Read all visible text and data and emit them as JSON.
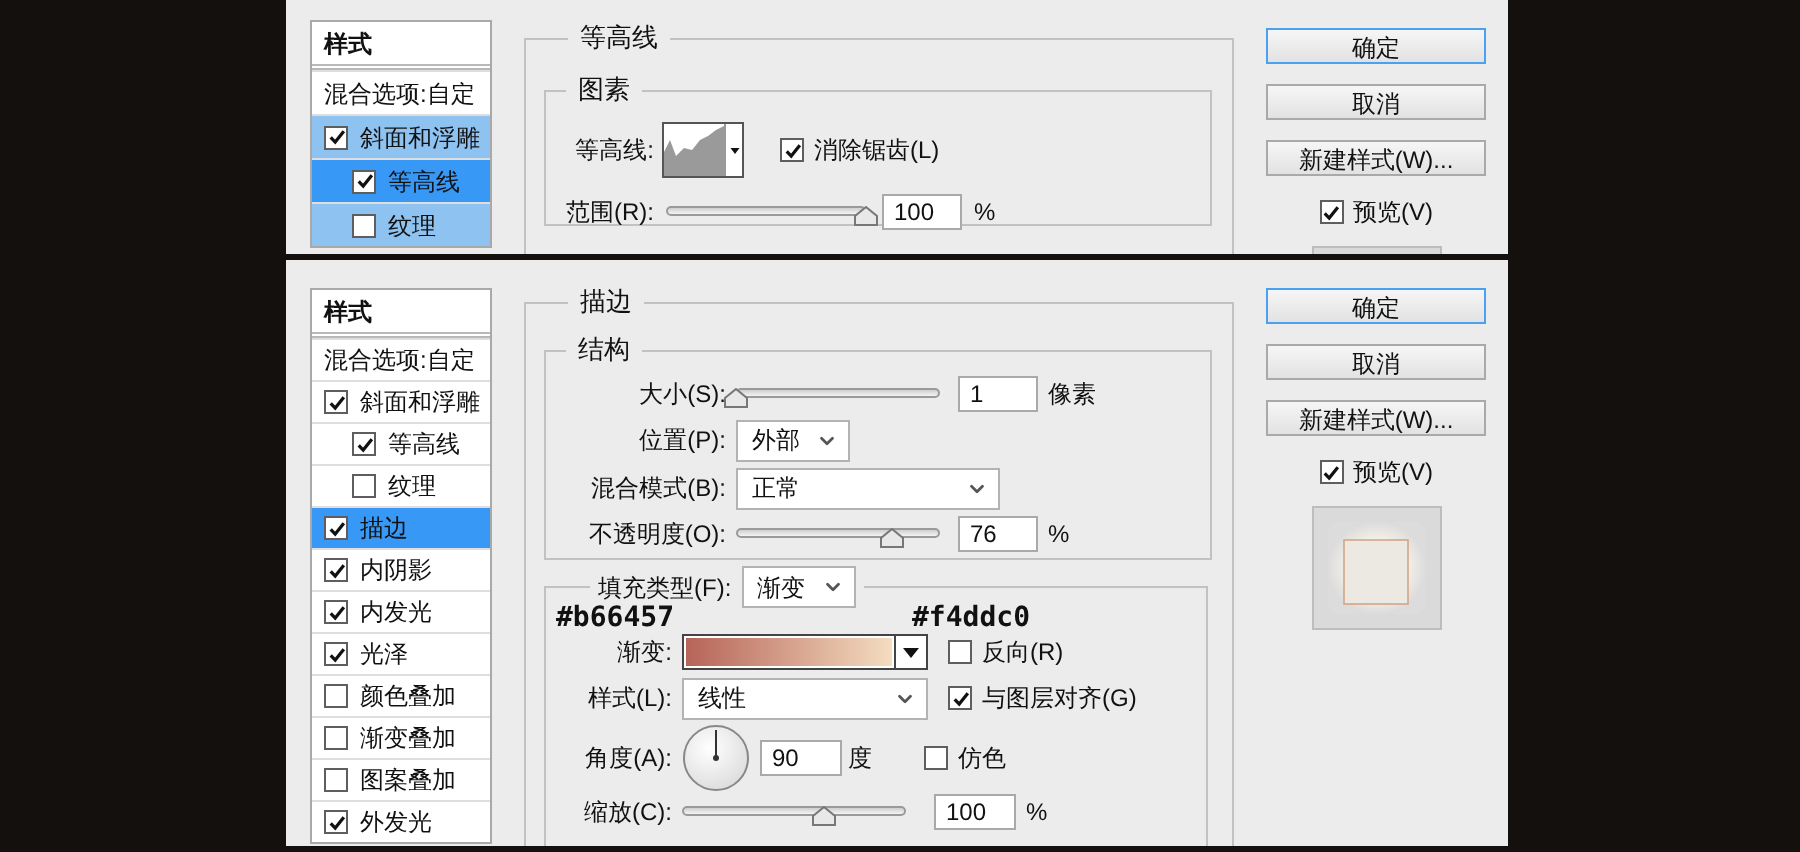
{
  "dialogs": [
    {
      "sidebar": {
        "title": "样式",
        "items": [
          {
            "kind": "option",
            "label": "混合选项:自定",
            "selected": false
          },
          {
            "kind": "effect",
            "label": "斜面和浮雕",
            "checked": true,
            "selected": false,
            "children": [
              {
                "kind": "effect",
                "label": "等高线",
                "checked": true,
                "selected": true
              },
              {
                "kind": "effect",
                "label": "纹理",
                "checked": false,
                "selected": false
              }
            ]
          }
        ]
      },
      "section": {
        "kind": "contour",
        "title": "等高线",
        "group_title": "图素",
        "contour_label": "等高线:",
        "anti_alias": {
          "label": "消除锯齿(L)",
          "checked": true
        },
        "range": {
          "label": "范围(R):",
          "level": 1,
          "value": "100",
          "unit": "%"
        }
      },
      "buttons": [
        {
          "label": "确定",
          "selected": true
        },
        {
          "label": "取消",
          "selected": false
        },
        {
          "label": "新建样式(W)...",
          "selected": false
        }
      ],
      "preview": {
        "label": "预览(V)",
        "checked": true
      }
    },
    {
      "sidebar": {
        "title": "样式",
        "items": [
          {
            "kind": "option",
            "label": "混合选项:自定",
            "selected": false
          },
          {
            "kind": "effect",
            "label": "斜面和浮雕",
            "checked": true,
            "selected": false,
            "children": [
              {
                "kind": "effect",
                "label": "等高线",
                "checked": true,
                "selected": false
              },
              {
                "kind": "effect",
                "label": "纹理",
                "checked": false,
                "selected": false
              }
            ]
          },
          {
            "kind": "effect",
            "label": "描边",
            "checked": true,
            "selected": true
          },
          {
            "kind": "effect",
            "label": "内阴影",
            "checked": true,
            "selected": false
          },
          {
            "kind": "effect",
            "label": "内发光",
            "checked": true,
            "selected": false
          },
          {
            "kind": "effect",
            "label": "光泽",
            "checked": true,
            "selected": false
          },
          {
            "kind": "effect",
            "label": "颜色叠加",
            "checked": false,
            "selected": false
          },
          {
            "kind": "effect",
            "label": "渐变叠加",
            "checked": false,
            "selected": false
          },
          {
            "kind": "effect",
            "label": "图案叠加",
            "checked": false,
            "selected": false
          },
          {
            "kind": "effect",
            "label": "外发光",
            "checked": true,
            "selected": false
          }
        ]
      },
      "section": {
        "kind": "stroke",
        "title": "描边",
        "group_title": "结构",
        "size": {
          "label": "大小(S):",
          "level": 0,
          "value": "1",
          "unit": "像素"
        },
        "position": {
          "label": "位置(P):",
          "value": "外部"
        },
        "blend_mode": {
          "label": "混合模式(B):",
          "value": "正常"
        },
        "opacity": {
          "label": "不透明度(O):",
          "level": 0.76,
          "value": "76",
          "unit": "%"
        },
        "fill": {
          "label": "填充类型(F):",
          "value": "渐变",
          "gradient": {
            "label": "渐变:",
            "stops": [
              {
                "label": "#b66457",
                "color": "#b66457"
              },
              {
                "label": "#f4ddc0",
                "color": "#f4ddc0"
              }
            ],
            "reverse": {
              "label": "反向(R)",
              "checked": false
            }
          },
          "style": {
            "label": "样式(L):",
            "value": "线性"
          },
          "align": {
            "label": "与图层对齐(G)",
            "checked": true
          },
          "angle": {
            "label": "角度(A):",
            "value": "90",
            "unit": "度"
          },
          "dither": {
            "label": "仿色",
            "checked": false
          },
          "scale": {
            "label": "缩放(C):",
            "level": 0.63,
            "value": "100",
            "unit": "%"
          }
        }
      },
      "buttons": [
        {
          "label": "确定",
          "selected": true
        },
        {
          "label": "取消",
          "selected": false
        },
        {
          "label": "新建样式(W)...",
          "selected": false
        }
      ],
      "preview": {
        "label": "预览(V)",
        "checked": true
      }
    }
  ]
}
